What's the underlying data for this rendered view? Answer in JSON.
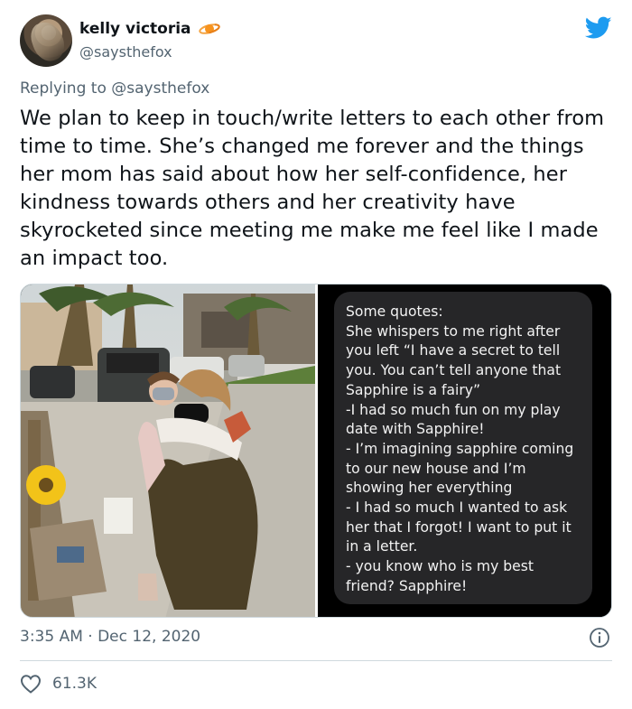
{
  "author": {
    "display_name": "kelly victoria",
    "handle": "@saysthefox",
    "badge_icon": "planet-emoji-icon",
    "avatar_icon": "profile-avatar"
  },
  "brand": {
    "icon": "twitter-bird-icon",
    "color": "#1d9bf0"
  },
  "reply": {
    "prefix": "Replying to ",
    "target": "@saysthefox"
  },
  "tweet": {
    "text": "We plan to keep in touch/write letters to each other from time to time. She’s changed me forever and the things her mom has said about how her self-confidence, her kindness towards others and her creativity have skyrocketed since meeting me make me feel like I made an impact too."
  },
  "media": {
    "photo_icon": "photo-two-people-hugging",
    "message_bubble_text": "Some quotes:\nShe whispers to me right after you left “I have a secret to tell you. You can’t tell anyone that Sapphire is a fairy”\n-I had so much fun on my play date with Sapphire!\n- I’m imagining sapphire coming to our new house and I’m showing her everything\n- I had so much I wanted to ask her that I forgot! I want to put it in a letter.\n- you know who is my best friend? Sapphire!"
  },
  "meta": {
    "timestamp": "3:35 AM · Dec 12, 2020",
    "info_icon": "info-icon"
  },
  "engagement": {
    "like_icon": "heart-outline-icon",
    "like_count": "61.3K"
  }
}
